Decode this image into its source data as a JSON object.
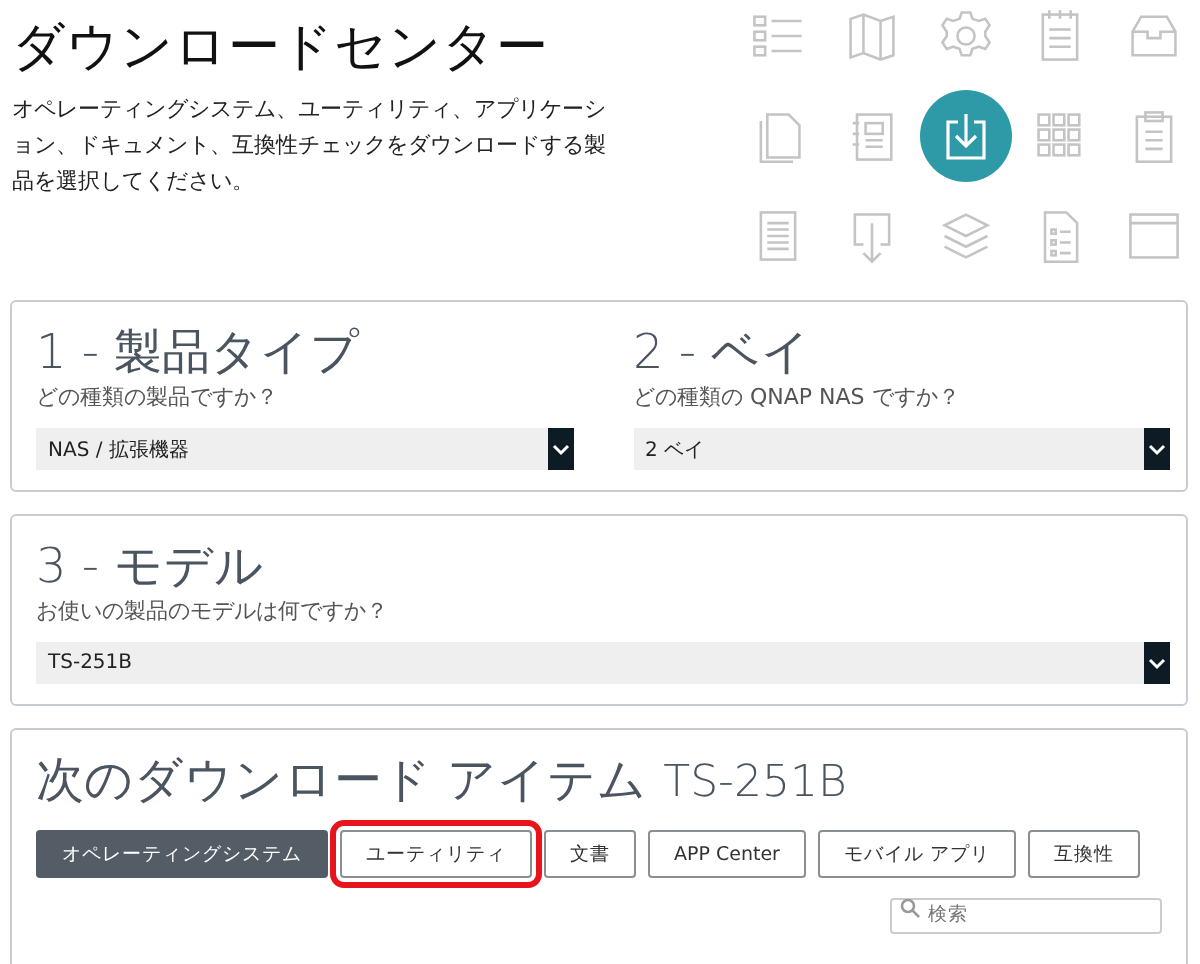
{
  "header": {
    "title": "ダウンロードセンター",
    "description": "オペレーティングシステム、ユーティリティ、アプリケーション、ドキュメント、互換性チェックをダウンロードする製品を選択してください。"
  },
  "icon_grid": [
    {
      "selected": false
    },
    {
      "selected": false
    },
    {
      "selected": false
    },
    {
      "selected": false
    },
    {
      "selected": false
    },
    {
      "selected": false
    },
    {
      "selected": false
    },
    {
      "selected": true
    },
    {
      "selected": false
    },
    {
      "selected": false
    },
    {
      "selected": false
    },
    {
      "selected": false
    },
    {
      "selected": false
    },
    {
      "selected": false
    },
    {
      "selected": false
    }
  ],
  "panels": [
    {
      "steps": [
        {
          "heading": "1 - 製品タイプ",
          "question": "どの種類の製品ですか？",
          "value": "NAS / 拡張機器"
        },
        {
          "heading": "2 - ベイ",
          "question": "どの種類の QNAP NAS ですか？",
          "value": "2 ベイ"
        }
      ]
    },
    {
      "steps": [
        {
          "heading": "3 - モデル",
          "question": "お使いの製品のモデルは何ですか？",
          "value": "TS-251B"
        }
      ]
    }
  ],
  "downloads": {
    "heading": "次のダウンロード アイテム",
    "model": "TS-251B",
    "tabs": [
      {
        "label": "オペレーティングシステム",
        "selected": true,
        "highlighted": false
      },
      {
        "label": "ユーティリティ",
        "selected": false,
        "highlighted": true
      },
      {
        "label": "文書",
        "selected": false,
        "highlighted": false
      },
      {
        "label": "APP Center",
        "selected": false,
        "highlighted": false
      },
      {
        "label": "モバイル アプリ",
        "selected": false,
        "highlighted": false
      },
      {
        "label": "互換性",
        "selected": false,
        "highlighted": false
      }
    ],
    "search": {
      "placeholder": "検索"
    }
  }
}
